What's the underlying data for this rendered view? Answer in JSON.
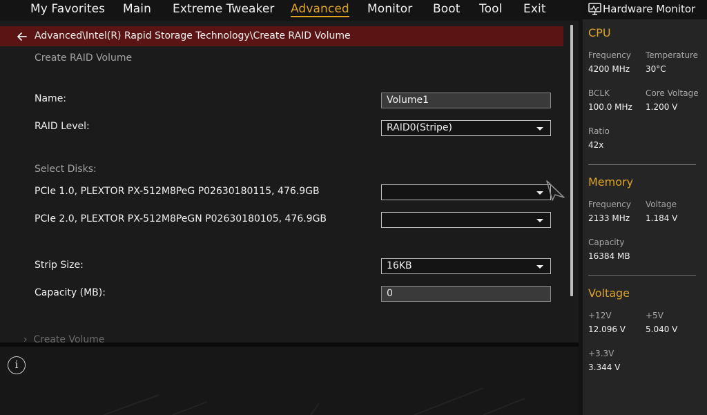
{
  "nav": {
    "items": [
      "My Favorites",
      "Main",
      "Extreme Tweaker",
      "Advanced",
      "Monitor",
      "Boot",
      "Tool",
      "Exit"
    ],
    "active": "Advanced"
  },
  "main": {
    "breadcrumb": "Advanced\\Intel(R) Rapid Storage Technology\\Create RAID Volume",
    "subtitle": "Create RAID Volume",
    "name_label": "Name:",
    "name_value": "Volume1",
    "raid_level_label": "RAID Level:",
    "raid_level_value": "RAID0(Stripe)",
    "select_disks_label": "Select Disks:",
    "disk1_label": "PCIe 1.0, PLEXTOR PX-512M8PeG P02630180115, 476.9GB",
    "disk1_value": "",
    "disk2_label": "PCIe 2.0, PLEXTOR PX-512M8PeGN P02630180105, 476.9GB",
    "disk2_value": "",
    "strip_size_label": "Strip Size:",
    "strip_size_value": "16KB",
    "capacity_label": "Capacity (MB):",
    "capacity_value": "0",
    "create_volume_label": "Create Volume"
  },
  "hw_monitor": {
    "title": "Hardware Monitor",
    "cpu": {
      "title": "CPU",
      "frequency_label": "Frequency",
      "frequency_value": "4200 MHz",
      "temperature_label": "Temperature",
      "temperature_value": "30°C",
      "bclk_label": "BCLK",
      "bclk_value": "100.0 MHz",
      "core_voltage_label": "Core Voltage",
      "core_voltage_value": "1.200 V",
      "ratio_label": "Ratio",
      "ratio_value": "42x"
    },
    "memory": {
      "title": "Memory",
      "frequency_label": "Frequency",
      "frequency_value": "2133 MHz",
      "voltage_label": "Voltage",
      "voltage_value": "1.184 V",
      "capacity_label": "Capacity",
      "capacity_value": "16384 MB"
    },
    "voltage": {
      "title": "Voltage",
      "v12_label": "+12V",
      "v12_value": "12.096 V",
      "v5_label": "+5V",
      "v5_value": "5.040 V",
      "v33_label": "+3.3V",
      "v33_value": "3.344 V"
    }
  },
  "colors": {
    "accent": "#e0a51f",
    "breadcrumb_bg": "#5b1414"
  }
}
